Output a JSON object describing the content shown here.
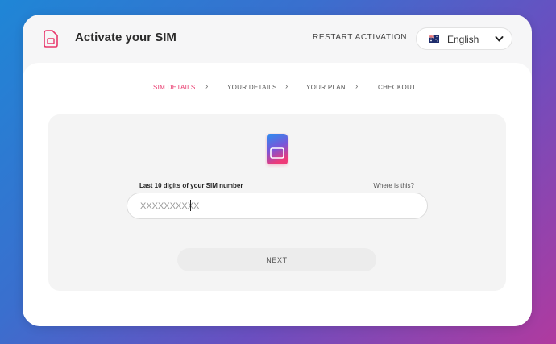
{
  "app": {
    "title": "Activate your SIM",
    "restart_label": "RESTART ACTIVATION"
  },
  "language": {
    "selected": "English",
    "flag": "australia-flag"
  },
  "steps": [
    {
      "label": "SIM DETAILS",
      "active": true
    },
    {
      "label": "YOUR DETAILS",
      "active": false
    },
    {
      "label": "YOUR PLAN",
      "active": false
    },
    {
      "label": "CHECKOUT",
      "active": false
    }
  ],
  "form": {
    "field_label": "Last 10 digits of your SIM number",
    "help_link": "Where is this?",
    "sim_input": {
      "value": "",
      "placeholder": "XXXXXXXXXX"
    },
    "next_label": "NEXT"
  },
  "colors": {
    "accent": "#e8366b",
    "gradient_start": "#1f86d6",
    "gradient_end": "#b03a9f"
  }
}
